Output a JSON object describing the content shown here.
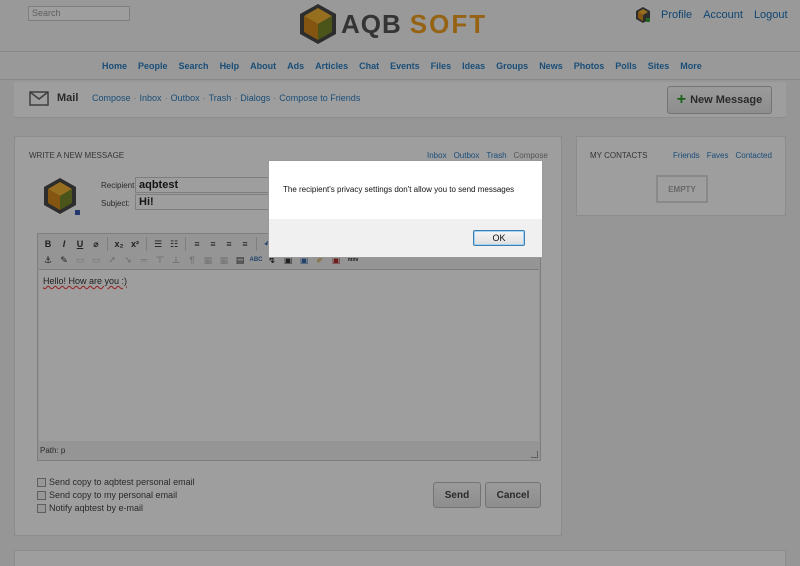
{
  "header": {
    "search_placeholder": "Search",
    "logo_text_a": "AQB",
    "logo_text_b": "SOFT",
    "user_links": [
      "Profile",
      "Account",
      "Logout"
    ]
  },
  "nav": {
    "items": [
      "Home",
      "People",
      "Search",
      "Help",
      "About",
      "Ads",
      "Articles",
      "Chat",
      "Events",
      "Files",
      "Ideas",
      "Groups",
      "News",
      "Photos",
      "Polls",
      "Sites",
      "More"
    ]
  },
  "mailbar": {
    "title": "Mail",
    "links": [
      "Compose",
      "Inbox",
      "Outbox",
      "Trash",
      "Dialogs",
      "Compose to Friends"
    ],
    "separator": "·",
    "new_message_label": "New Message"
  },
  "compose": {
    "section_title": "WRITE A NEW MESSAGE",
    "box_links": [
      "Inbox",
      "Outbox",
      "Trash",
      "Compose"
    ],
    "recipient_label": "Recipient:",
    "recipient_value": "aqbtest",
    "subject_label": "Subject:",
    "subject_value": "Hi!",
    "toolbar_row1": [
      "B",
      "I",
      "U",
      "⌀",
      "x₂",
      "x²",
      "☰",
      "☷",
      "≡",
      "≡",
      "≡",
      "≡",
      "↶"
    ],
    "toolbar_row2": [
      "⚓",
      "✎",
      "▭",
      "▭",
      "↗",
      "↘",
      "═",
      "⊤",
      "⊥",
      "¶",
      "▦",
      "▦",
      "▤",
      "ABC",
      "↯",
      "▣",
      "▣",
      "✐",
      "▣",
      "html"
    ],
    "body_text": "Hello! How are you :)",
    "path_text": "Path: p",
    "options": [
      "Send copy to aqbtest personal email",
      "Send copy to my personal email",
      "Notify aqbtest by e-mail"
    ],
    "send_label": "Send",
    "cancel_label": "Cancel"
  },
  "contacts": {
    "section_title": "MY CONTACTS",
    "links": [
      "Friends",
      "Faves",
      "Contacted"
    ],
    "empty_label": "EMPTY"
  },
  "dialog": {
    "message": "The recipient's privacy settings don't allow you to send messages",
    "ok_label": "OK"
  },
  "colors": {
    "link": "#2a7ec2",
    "logo_orange": "#f0a020",
    "overlay": "rgba(0,0,0,0.38)"
  }
}
